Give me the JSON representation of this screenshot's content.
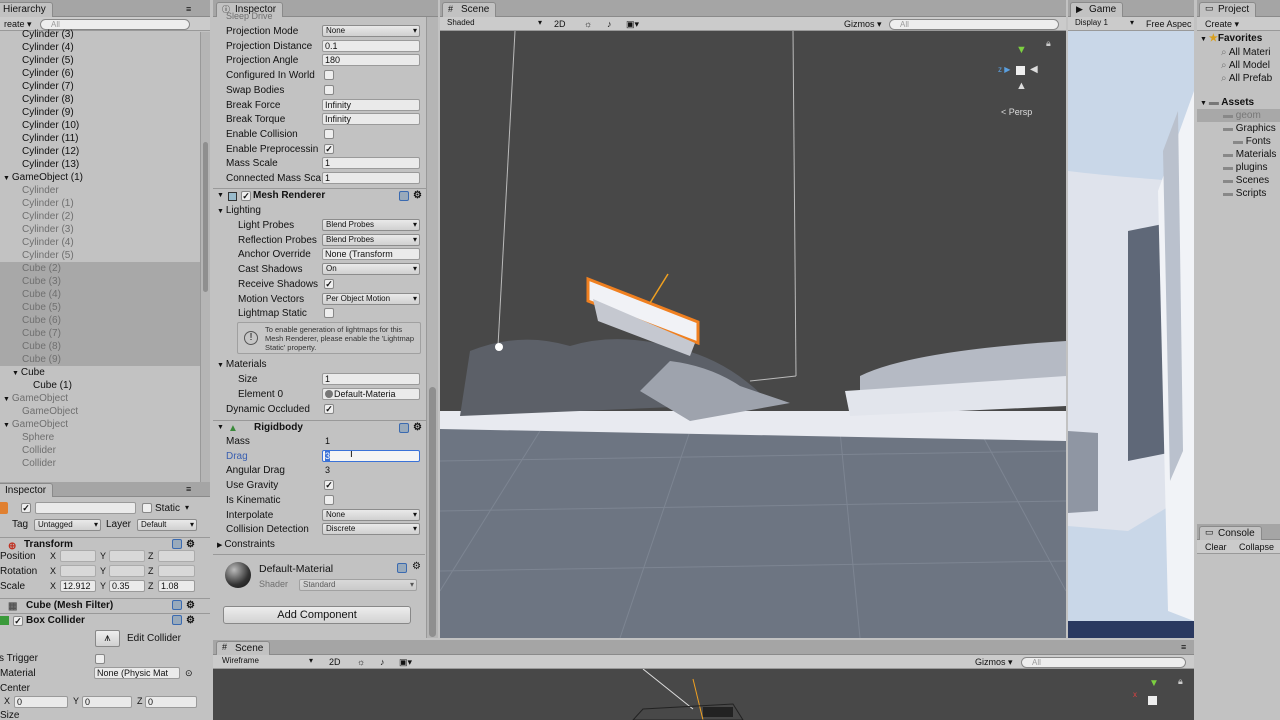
{
  "hierarchy": {
    "tab": "Hierarchy",
    "create": "reate ▾",
    "search_placeholder": "All",
    "items": [
      {
        "label": "Cylinder (3)",
        "indent": 1,
        "gray": false,
        "sel": false
      },
      {
        "label": "Cylinder (4)",
        "indent": 1,
        "gray": false,
        "sel": false
      },
      {
        "label": "Cylinder (5)",
        "indent": 1,
        "gray": false,
        "sel": false
      },
      {
        "label": "Cylinder (6)",
        "indent": 1,
        "gray": false,
        "sel": false
      },
      {
        "label": "Cylinder (7)",
        "indent": 1,
        "gray": false,
        "sel": false
      },
      {
        "label": "Cylinder (8)",
        "indent": 1,
        "gray": false,
        "sel": false
      },
      {
        "label": "Cylinder (9)",
        "indent": 1,
        "gray": false,
        "sel": false
      },
      {
        "label": "Cylinder (10)",
        "indent": 1,
        "gray": false,
        "sel": false
      },
      {
        "label": "Cylinder (11)",
        "indent": 1,
        "gray": false,
        "sel": false
      },
      {
        "label": "Cylinder (12)",
        "indent": 1,
        "gray": false,
        "sel": false
      },
      {
        "label": "Cylinder (13)",
        "indent": 1,
        "gray": false,
        "sel": false
      },
      {
        "label": "GameObject (1)",
        "indent": 0,
        "gray": false,
        "sel": false,
        "fold": "▼"
      },
      {
        "label": "Cylinder",
        "indent": 1,
        "gray": true,
        "sel": false
      },
      {
        "label": "Cylinder (1)",
        "indent": 1,
        "gray": true,
        "sel": false
      },
      {
        "label": "Cylinder (2)",
        "indent": 1,
        "gray": true,
        "sel": false
      },
      {
        "label": "Cylinder (3)",
        "indent": 1,
        "gray": true,
        "sel": false
      },
      {
        "label": "Cylinder (4)",
        "indent": 1,
        "gray": true,
        "sel": false
      },
      {
        "label": "Cylinder (5)",
        "indent": 1,
        "gray": true,
        "sel": false
      },
      {
        "label": "Cube (2)",
        "indent": 1,
        "gray": true,
        "sel": true
      },
      {
        "label": "Cube (3)",
        "indent": 1,
        "gray": true,
        "sel": true
      },
      {
        "label": "Cube (4)",
        "indent": 1,
        "gray": true,
        "sel": true
      },
      {
        "label": "Cube (5)",
        "indent": 1,
        "gray": true,
        "sel": true
      },
      {
        "label": "Cube (6)",
        "indent": 1,
        "gray": true,
        "sel": true
      },
      {
        "label": "Cube (7)",
        "indent": 1,
        "gray": true,
        "sel": true
      },
      {
        "label": "Cube (8)",
        "indent": 1,
        "gray": true,
        "sel": true
      },
      {
        "label": "Cube (9)",
        "indent": 1,
        "gray": true,
        "sel": true
      },
      {
        "label": "Cube",
        "indent": 1,
        "gray": false,
        "sel": false,
        "fold": "▼"
      },
      {
        "label": "Cube (1)",
        "indent": 2,
        "gray": false,
        "sel": false
      },
      {
        "label": "GameObject",
        "indent": 0,
        "gray": true,
        "sel": false,
        "fold": "▼"
      },
      {
        "label": "GameObject",
        "indent": 1,
        "gray": true,
        "sel": false
      },
      {
        "label": "GameObject",
        "indent": 0,
        "gray": true,
        "sel": false,
        "fold": "▼"
      },
      {
        "label": "Sphere",
        "indent": 1,
        "gray": true,
        "sel": false
      },
      {
        "label": "Collider",
        "indent": 1,
        "gray": true,
        "sel": false
      },
      {
        "label": "Collider",
        "indent": 1,
        "gray": true,
        "sel": false
      }
    ]
  },
  "inspector_left": {
    "tab": "Inspector",
    "static_label": "Static",
    "tag_label": "Tag",
    "tag_value": "Untagged",
    "layer_label": "Layer",
    "layer_value": "Default",
    "transform_title": "Transform",
    "position_label": "Position",
    "rotation_label": "Rotation",
    "scale_label": "Scale",
    "x": "X",
    "y": "Y",
    "z": "Z",
    "scale_x": "12.912",
    "scale_y": "0.35",
    "scale_z": "1.08",
    "mesh_filter_title": "Cube (Mesh Filter)",
    "box_collider_title": "Box Collider",
    "edit_collider": "Edit Collider",
    "is_trigger_label": "s Trigger",
    "material_label": "Material",
    "material_value": "None (Physic Mat",
    "center_label": "Center",
    "center_x": "0",
    "center_y": "0",
    "center_z": "0",
    "size_label": "Size"
  },
  "inspector_main": {
    "tab": "Inspector",
    "clipped_top": "Sleep Drive",
    "joint_rows": [
      {
        "label": "Projection Mode",
        "kind": "drop",
        "value": "None"
      },
      {
        "label": "Projection Distance",
        "kind": "fld",
        "value": "0.1"
      },
      {
        "label": "Projection Angle",
        "kind": "fld",
        "value": "180"
      },
      {
        "label": "Configured In World",
        "kind": "chk",
        "value": ""
      },
      {
        "label": "Swap Bodies",
        "kind": "chk",
        "value": ""
      },
      {
        "label": "Break Force",
        "kind": "fld",
        "value": "Infinity"
      },
      {
        "label": "Break Torque",
        "kind": "fld",
        "value": "Infinity"
      },
      {
        "label": "Enable Collision",
        "kind": "chk",
        "value": ""
      },
      {
        "label": "Enable Preprocessin",
        "kind": "chk",
        "value": "✓"
      },
      {
        "label": "Mass Scale",
        "kind": "fld",
        "value": "1"
      },
      {
        "label": "Connected Mass Sca",
        "kind": "fld",
        "value": "1"
      }
    ],
    "mesh_renderer_title": "Mesh Renderer",
    "lighting_label": "Lighting",
    "lighting_rows": [
      {
        "label": "Light Probes",
        "kind": "drop",
        "value": "Blend Probes"
      },
      {
        "label": "Reflection Probes",
        "kind": "drop",
        "value": "Blend Probes"
      },
      {
        "label": "Anchor Override",
        "kind": "fld",
        "value": "None (Transform"
      },
      {
        "label": "Cast Shadows",
        "kind": "drop",
        "value": "On"
      },
      {
        "label": "Receive Shadows",
        "kind": "chk",
        "value": "✓"
      },
      {
        "label": "Motion Vectors",
        "kind": "drop",
        "value": "Per Object Motion"
      },
      {
        "label": "Lightmap Static",
        "kind": "chk",
        "value": ""
      }
    ],
    "lightmap_info": "To enable generation of lightmaps for this Mesh Renderer, please enable the 'Lightmap Static' property.",
    "materials_label": "Materials",
    "size_label": "Size",
    "size_value": "1",
    "element0_label": "Element 0",
    "element0_value": "Default-Materia",
    "dynamic_occluded_label": "Dynamic Occluded",
    "rigidbody_title": "Rigidbody",
    "mass_label": "Mass",
    "mass_value": "1",
    "drag_label": "Drag",
    "drag_value": "3",
    "angular_drag_label": "Angular Drag",
    "angular_drag_value": "3",
    "use_gravity_label": "Use Gravity",
    "is_kinematic_label": "Is Kinematic",
    "interpolate_label": "Interpolate",
    "interpolate_value": "None",
    "collision_detection_label": "Collision Detection",
    "collision_detection_value": "Discrete",
    "constraints_label": "Constraints",
    "material_name": "Default-Material",
    "shader_label": "Shader",
    "shader_value": "Standard",
    "add_component": "Add Component"
  },
  "scene": {
    "tab": "Scene",
    "shading": "Shaded",
    "mode_2d": "2D",
    "gizmos": "Gizmos ▾",
    "search_placeholder": "All",
    "persp": "< Persp"
  },
  "game": {
    "tab": "Game",
    "display": "Display 1",
    "aspect": "Free Aspec"
  },
  "project": {
    "tab": "Project",
    "create": "Create ▾",
    "favorites": "Favorites",
    "fav_items": [
      "All Materi",
      "All Model",
      "All Prefab"
    ],
    "assets": "Assets",
    "asset_items": [
      {
        "label": "geom",
        "indent": 1,
        "sel": true
      },
      {
        "label": "Graphics",
        "indent": 1,
        "sel": false
      },
      {
        "label": "Fonts",
        "indent": 2,
        "sel": false
      },
      {
        "label": "Materials",
        "indent": 1,
        "sel": false
      },
      {
        "label": "plugins",
        "indent": 1,
        "sel": false
      },
      {
        "label": "Scenes",
        "indent": 1,
        "sel": false
      },
      {
        "label": "Scripts",
        "indent": 1,
        "sel": false
      }
    ]
  },
  "console": {
    "tab": "Console",
    "clear": "Clear",
    "collapse": "Collapse"
  },
  "scene_bottom": {
    "tab": "Scene",
    "shading": "Wireframe",
    "mode_2d": "2D",
    "gizmos": "Gizmos ▾",
    "search_placeholder": "All"
  }
}
